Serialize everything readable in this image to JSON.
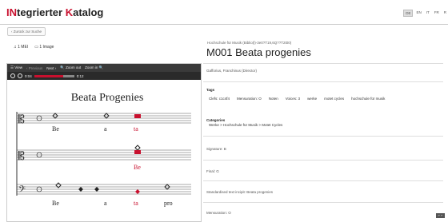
{
  "header": {
    "logo_prefix": "IN",
    "logo_mid": "tegrierter ",
    "logo_k": "K",
    "logo_rest": "atalog",
    "langs": [
      "DE",
      "EN",
      "IT",
      "FR",
      "R"
    ]
  },
  "back_label": "‹ Zurück zur Suche",
  "media_tabs": {
    "mei": "1 MEI",
    "image": "1 Image"
  },
  "viewer": {
    "toolbar": {
      "view": "☰ View",
      "previous": "‹ Previous",
      "next": "Next ›",
      "zoom_out": "🔍 Zoom out",
      "zoom_in": "Zoom in 🔍"
    },
    "player": {
      "time_start": "0:04",
      "time_end": "0:12",
      "progress": 0.72
    },
    "score": {
      "title": "Beata Progenies",
      "lyrics_row1": [
        "Be",
        "a",
        "ta"
      ],
      "lyrics_row2": [
        "Be"
      ],
      "lyrics_row3": [
        "Be",
        "a",
        "ta",
        "pro"
      ]
    }
  },
  "record": {
    "subtitle": "Hochschule für Musik (Biblio(l)-3e0?T19,6Q??T2t00)",
    "title": "M001 Beata progenies",
    "composer": "Gafforius, Franchinus (Director)",
    "tags_label": "Tags",
    "tags": [
      "Clefs: c1c4f4",
      "Mensuration: O",
      "Noten",
      "Voices: 3",
      "werke",
      "motet cycles",
      "hochschule für musik"
    ],
    "categories_label": "Categories",
    "categories": "Werke > Hochschule für Musik > Motet Cycles",
    "signature": "Signature: B",
    "final": "Final: G",
    "standardized_incipit": "Standardised text incipit: Beata progenies",
    "mensuration": "Mensuration: O"
  },
  "colors": {
    "accent": "#c8102e",
    "toolbar": "#3a3a3a"
  },
  "corner": "⌐ ⌐"
}
